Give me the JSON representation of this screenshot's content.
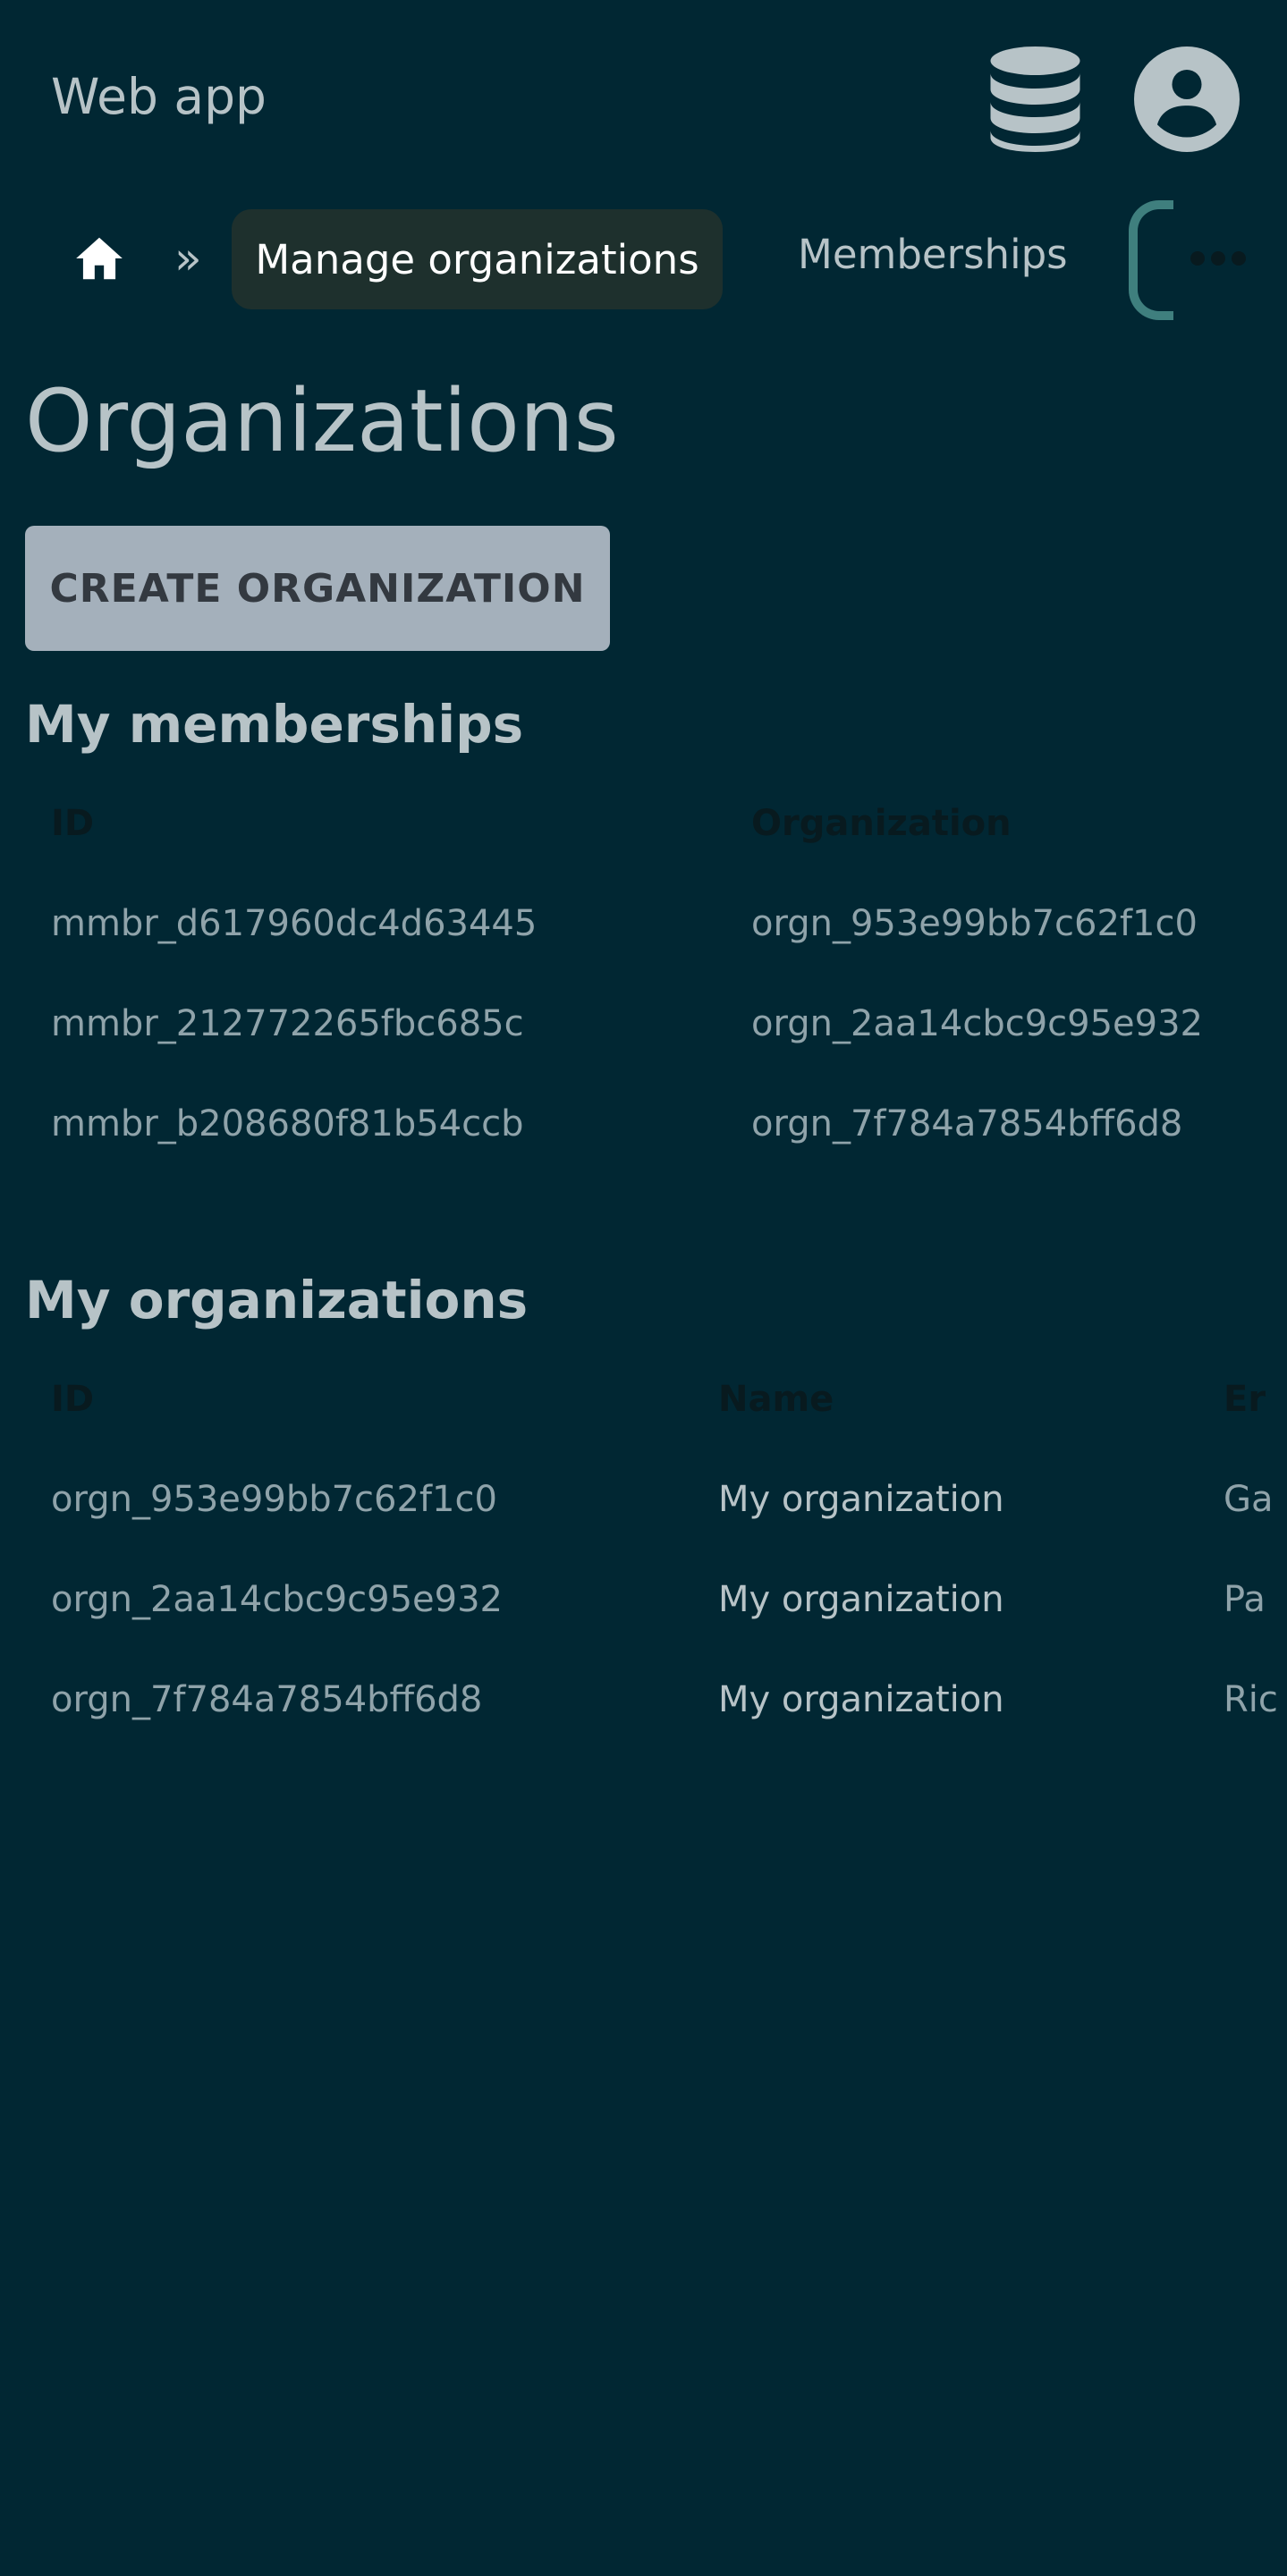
{
  "header": {
    "app_title": "Web app",
    "database_icon": "database-icon",
    "account_icon": "account-circle-icon"
  },
  "nav": {
    "home_icon": "home-icon",
    "separator": "»",
    "active_label": "Manage organizations",
    "links": [
      "Memberships"
    ],
    "overflow_icon": "more-horizontal-icon"
  },
  "page": {
    "title": "Organizations",
    "create_button_label": "CREATE ORGANIZATION"
  },
  "memberships": {
    "title": "My memberships",
    "columns": [
      "ID",
      "Organization"
    ],
    "rows": [
      {
        "id": "mmbr_d617960dc4d63445",
        "organization": "orgn_953e99bb7c62f1c0"
      },
      {
        "id": "mmbr_212772265fbc685c",
        "organization": "orgn_2aa14cbc9c95e932"
      },
      {
        "id": "mmbr_b208680f81b54ccb",
        "organization": "orgn_7f784a7854bff6d8"
      }
    ]
  },
  "organizations": {
    "title": "My organizations",
    "columns": [
      "ID",
      "Name",
      "Er"
    ],
    "rows": [
      {
        "id": "orgn_953e99bb7c62f1c0",
        "name": "My organization",
        "extra": "Ga"
      },
      {
        "id": "orgn_2aa14cbc9c95e932",
        "name": "My organization",
        "extra": "Pa"
      },
      {
        "id": "orgn_7f784a7854bff6d8",
        "name": "My organization",
        "extra": "Ric"
      }
    ]
  },
  "colors": {
    "background": "#012733",
    "text": "#b7c3c7",
    "active_pill": "#1e302d",
    "button": "#a4b0bb",
    "accent_edge": "#3f7f7e"
  }
}
